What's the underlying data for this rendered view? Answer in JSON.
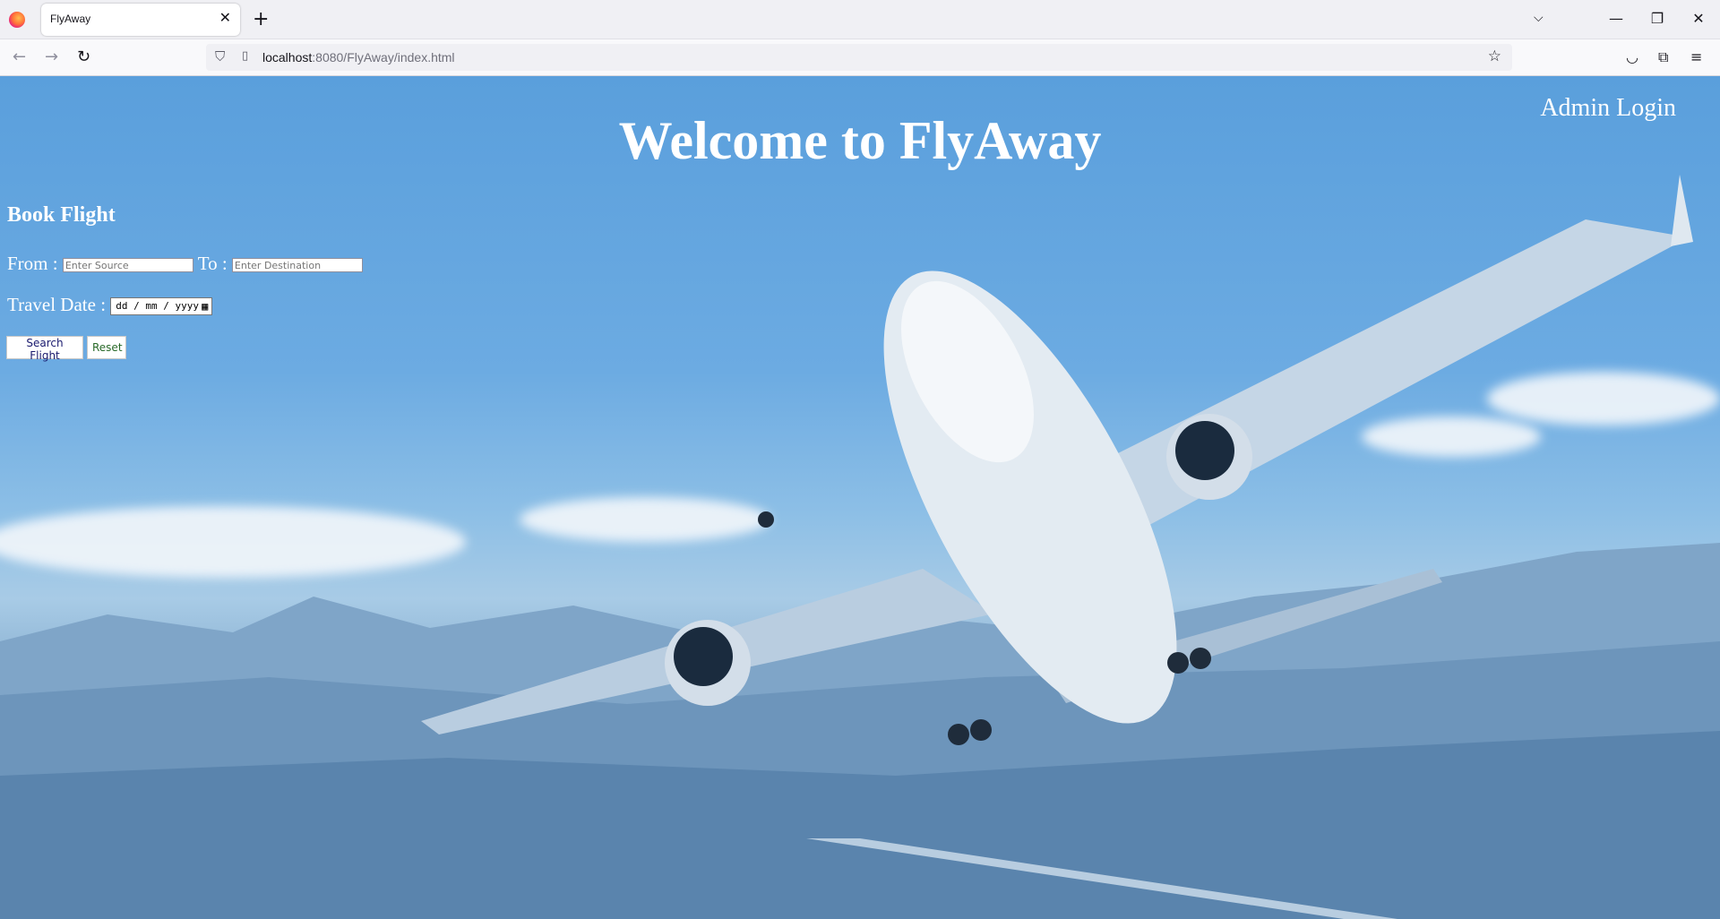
{
  "browser": {
    "tab_title": "FlyAway",
    "tab_close": "✕",
    "new_tab": "+",
    "tabs_list": "⌵",
    "window_controls": {
      "minimize": "—",
      "restore": "❐",
      "close": "✕"
    },
    "url_host": "localhost",
    "url_rest": ":8080/FlyAway/index.html",
    "nav": {
      "back": "←",
      "forward": "→",
      "reload": "↻"
    },
    "icons": [
      "shield-icon",
      "page-icon",
      "bookmark-star-icon",
      "pocket-icon",
      "extensions-icon",
      "menu-icon"
    ]
  },
  "header": {
    "title": "Welcome to FlyAway",
    "admin_link": "Admin Login"
  },
  "booking": {
    "heading": "Book Flight",
    "from_label": "From :",
    "from_placeholder": "Enter Source",
    "to_label": "To :",
    "to_placeholder": "Enter Destination",
    "date_label": "Travel Date :",
    "date_placeholder": "dd / mm / yyyy",
    "search_button": "Search Flight",
    "reset_button": "Reset"
  },
  "colors": {
    "sky": "#5a9fdc",
    "text": "#ffffff"
  }
}
